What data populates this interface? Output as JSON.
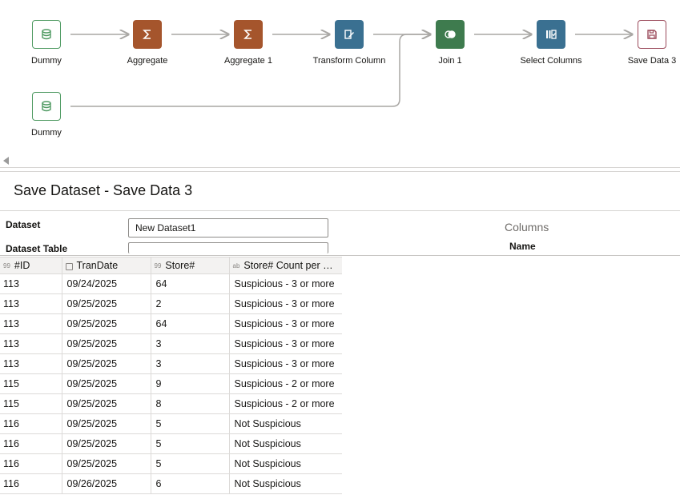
{
  "flow": {
    "nodes": [
      {
        "label": "Dummy",
        "icon": "database-icon",
        "kind": "source"
      },
      {
        "label": "Aggregate",
        "icon": "sigma-icon",
        "kind": "agg"
      },
      {
        "label": "Aggregate 1",
        "icon": "sigma-icon",
        "kind": "agg"
      },
      {
        "label": "Transform Column",
        "icon": "transform-icon",
        "kind": "transform"
      },
      {
        "label": "Join 1",
        "icon": "join-icon",
        "kind": "join"
      },
      {
        "label": "Select Columns",
        "icon": "select-columns-icon",
        "kind": "select"
      },
      {
        "label": "Save Data 3",
        "icon": "save-icon",
        "kind": "save"
      },
      {
        "label": "Dummy",
        "icon": "database-icon",
        "kind": "source"
      }
    ],
    "colors": {
      "source": "#4f9a62",
      "agg": "#a5552c",
      "transform": "#3a7091",
      "join": "#3e7b4e",
      "select": "#3a7091",
      "save": "#9b4a5b",
      "link": "#a9a7a4"
    }
  },
  "panel": {
    "title": "Save Dataset - Save Data 3",
    "dataset_label": "Dataset",
    "dataset_value": "New Dataset1",
    "dataset_table_label": "Dataset Table",
    "dataset_table_value": "",
    "columns_title": "Columns",
    "columns_name_header": "Name"
  },
  "grid": {
    "columns": [
      {
        "type_icon": "99",
        "label": "#ID"
      },
      {
        "type_icon": "calendar",
        "label": "TranDate"
      },
      {
        "type_icon": "99",
        "label": "Store#"
      },
      {
        "type_icon": "ab",
        "label": "Store# Count per #ID"
      }
    ],
    "rows": [
      [
        "113",
        "09/24/2025",
        "64",
        "Suspicious - 3 or more"
      ],
      [
        "113",
        "09/25/2025",
        "2",
        "Suspicious - 3 or more"
      ],
      [
        "113",
        "09/25/2025",
        "64",
        "Suspicious - 3 or more"
      ],
      [
        "113",
        "09/25/2025",
        "3",
        "Suspicious - 3 or more"
      ],
      [
        "113",
        "09/25/2025",
        "3",
        "Suspicious - 3 or more"
      ],
      [
        "115",
        "09/25/2025",
        "9",
        "Suspicious - 2 or more"
      ],
      [
        "115",
        "09/25/2025",
        "8",
        "Suspicious - 2 or more"
      ],
      [
        "116",
        "09/25/2025",
        "5",
        "Not Suspicious"
      ],
      [
        "116",
        "09/25/2025",
        "5",
        "Not Suspicious"
      ],
      [
        "116",
        "09/25/2025",
        "5",
        "Not Suspicious"
      ],
      [
        "116",
        "09/26/2025",
        "6",
        "Not Suspicious"
      ]
    ]
  }
}
